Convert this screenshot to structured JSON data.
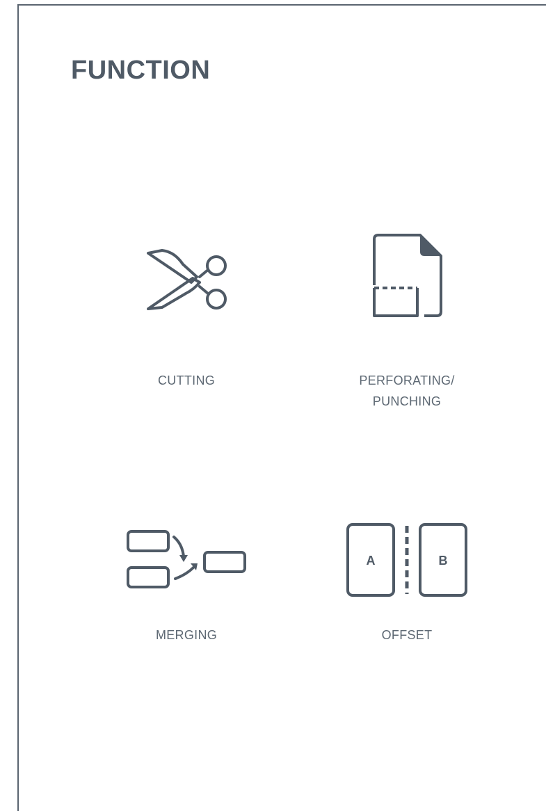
{
  "page": {
    "title": "FUNCTION"
  },
  "functions": [
    {
      "icon": "scissors-icon",
      "lines": [
        "CUTTING"
      ]
    },
    {
      "icon": "perforated-page-icon",
      "lines": [
        "PERFORATING/",
        "PUNCHING"
      ]
    },
    {
      "icon": "merge-icon",
      "lines": [
        "MERGING"
      ]
    },
    {
      "icon": "offset-stack-icon",
      "lines": [
        "OFFSET"
      ],
      "letters": [
        "A",
        "B"
      ]
    }
  ],
  "colors": {
    "ink": "#4f5a66",
    "frame": "#5a6470"
  }
}
